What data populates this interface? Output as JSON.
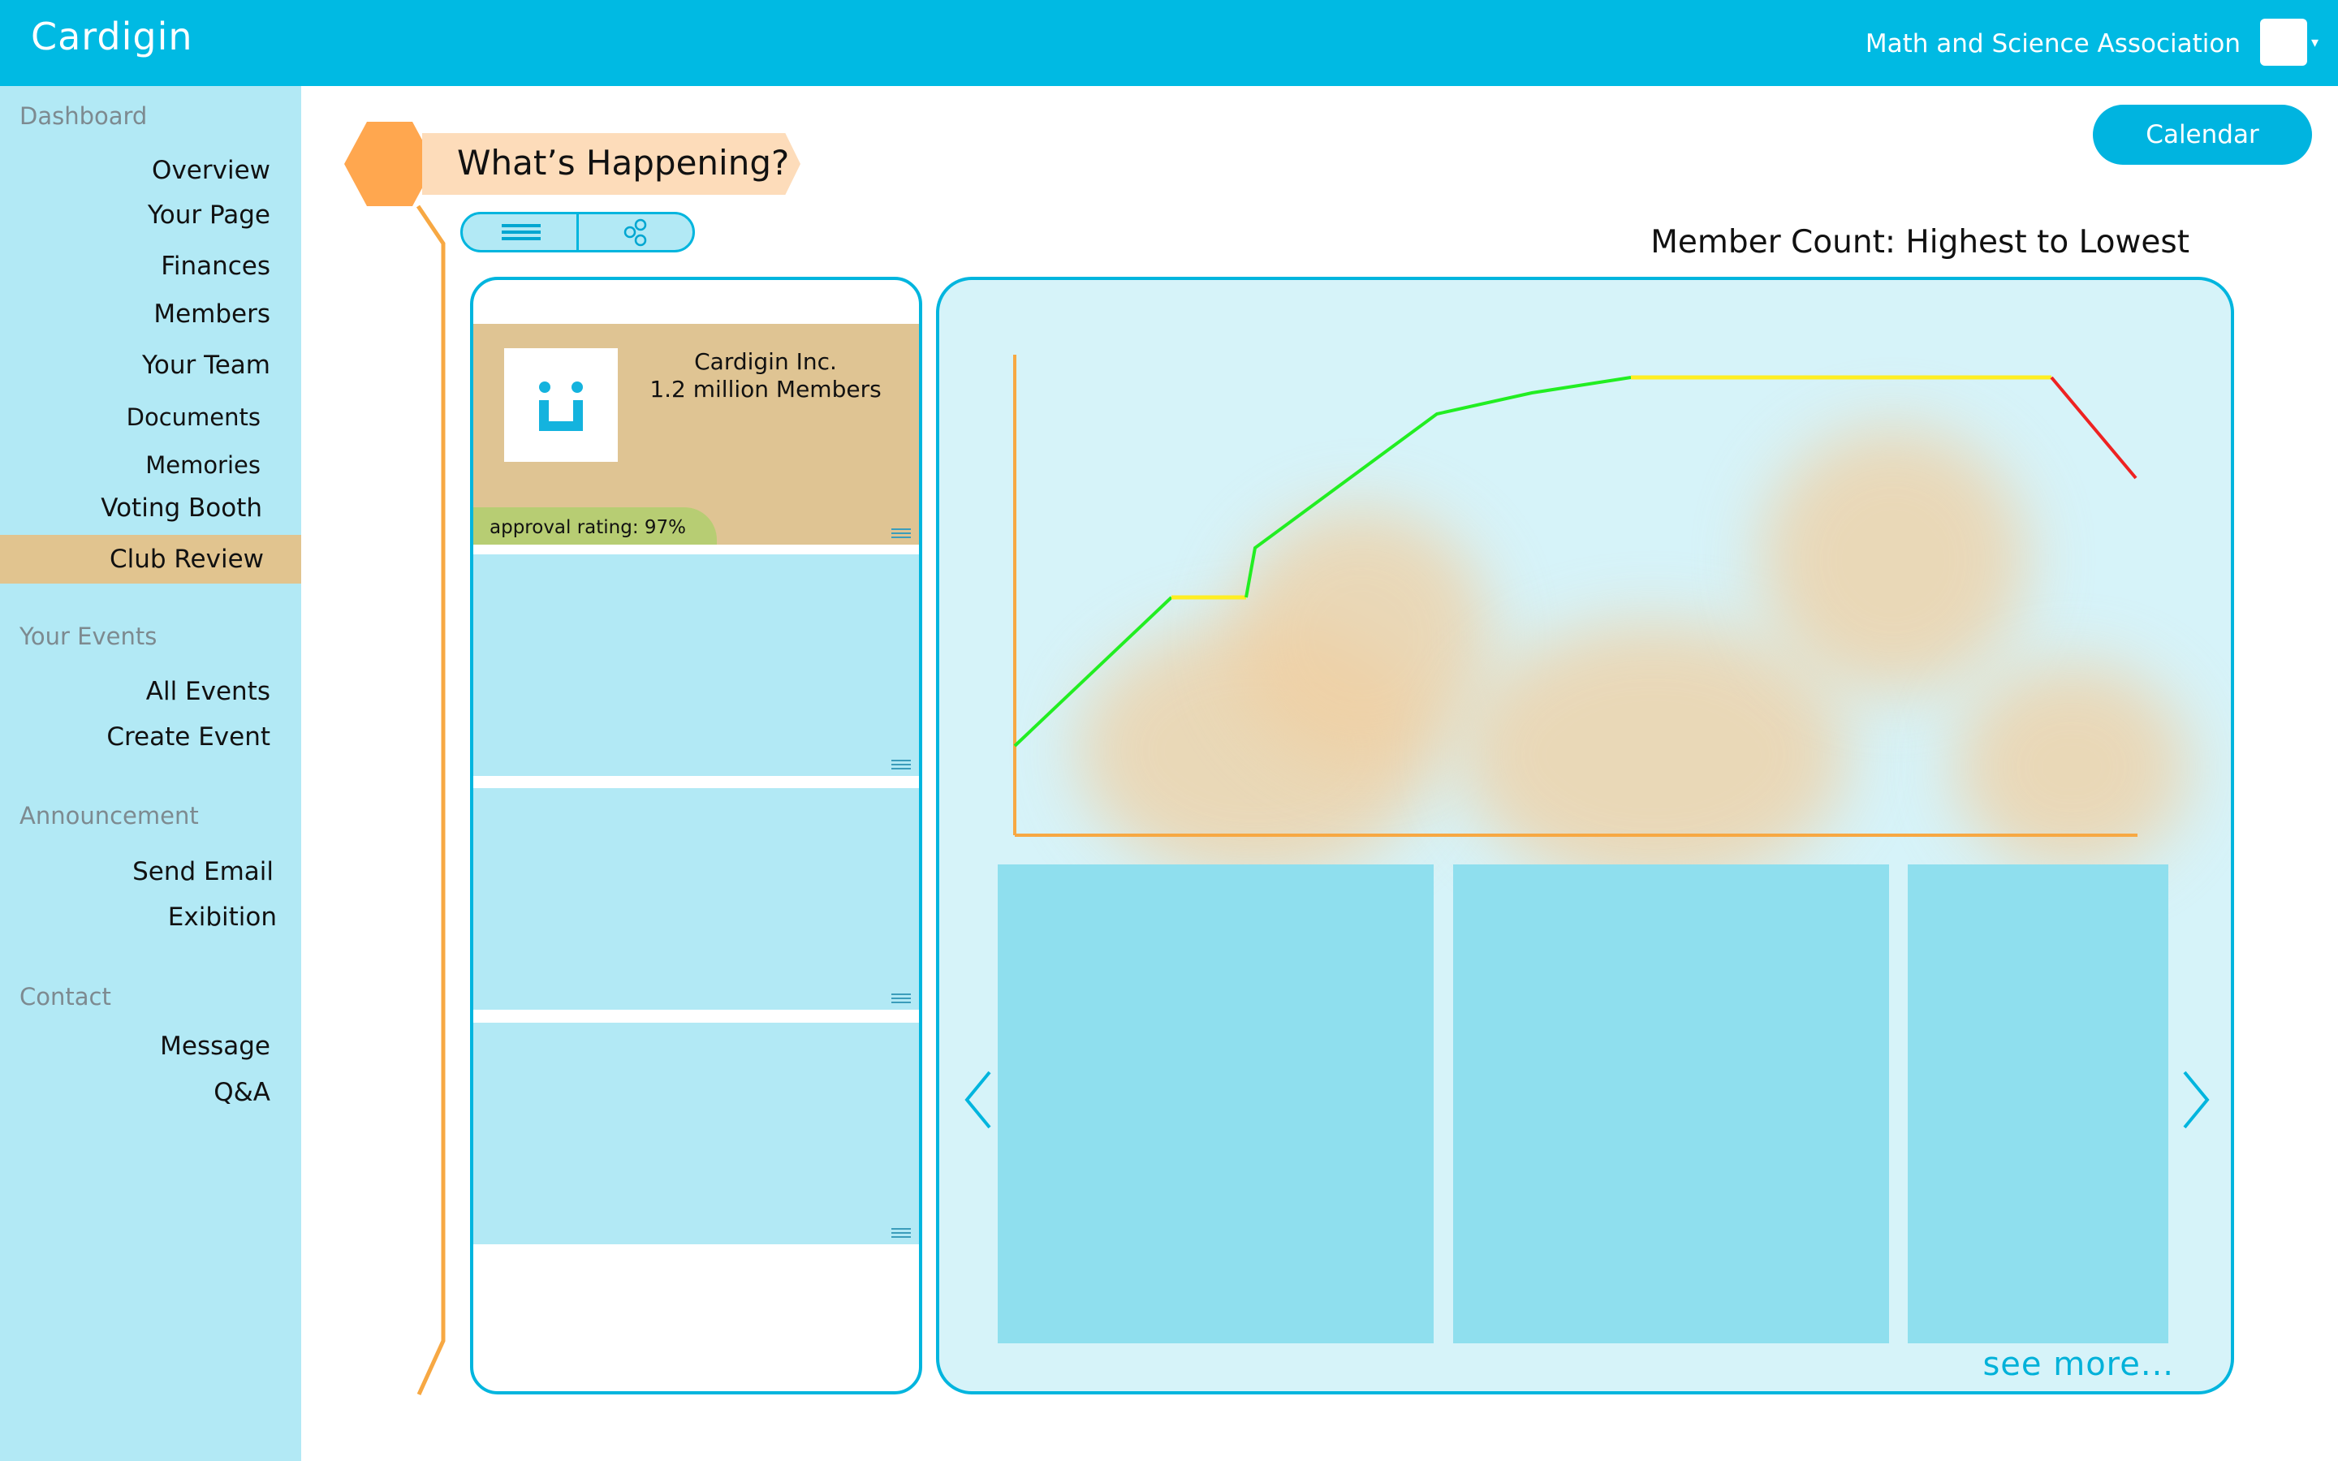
{
  "header": {
    "app_title": "Cardigin",
    "organization": "Math and Science Association",
    "dropdown_caret": "▾"
  },
  "sidebar": {
    "sections": [
      {
        "title": "Dashboard",
        "items": [
          "Overview",
          "Your Page",
          "Finances",
          "Members",
          "Your Team",
          "Documents",
          "Memories",
          "Voting Booth",
          "Club Review"
        ]
      },
      {
        "title": "Your Events",
        "items": [
          "All Events",
          "Create Event"
        ]
      },
      {
        "title": "Announcement",
        "items": [
          "Send Email",
          "Exibition"
        ]
      },
      {
        "title": "Contact",
        "items": [
          "Message",
          "Q&A"
        ]
      }
    ],
    "active_item": "Club Review"
  },
  "main": {
    "section_title": "What’s Happening?",
    "view_toggle": {
      "left_icon": "list-icon",
      "right_icon": "share-nodes-icon",
      "selected": "list"
    },
    "calendar_button": "Calendar",
    "chart_title": "Member Count: Highest to Lowest",
    "cards": [
      {
        "name": "Cardigin Inc.",
        "members": "1.2 million Members",
        "approval": "approval rating: 97%",
        "logo_icon": "cardigin-logo-icon"
      }
    ],
    "see_more": "see more...",
    "prev_icon": "chevron-left-icon",
    "next_icon": "chevron-right-icon"
  },
  "colors": {
    "topbar": "#00bae3",
    "sidebar": "#b2e9f5",
    "active": "#e1c48f",
    "accent_orange": "#ffa74f",
    "line_green": "#22ee22",
    "line_yellow": "#ffee22",
    "line_red": "#ee2222"
  }
}
